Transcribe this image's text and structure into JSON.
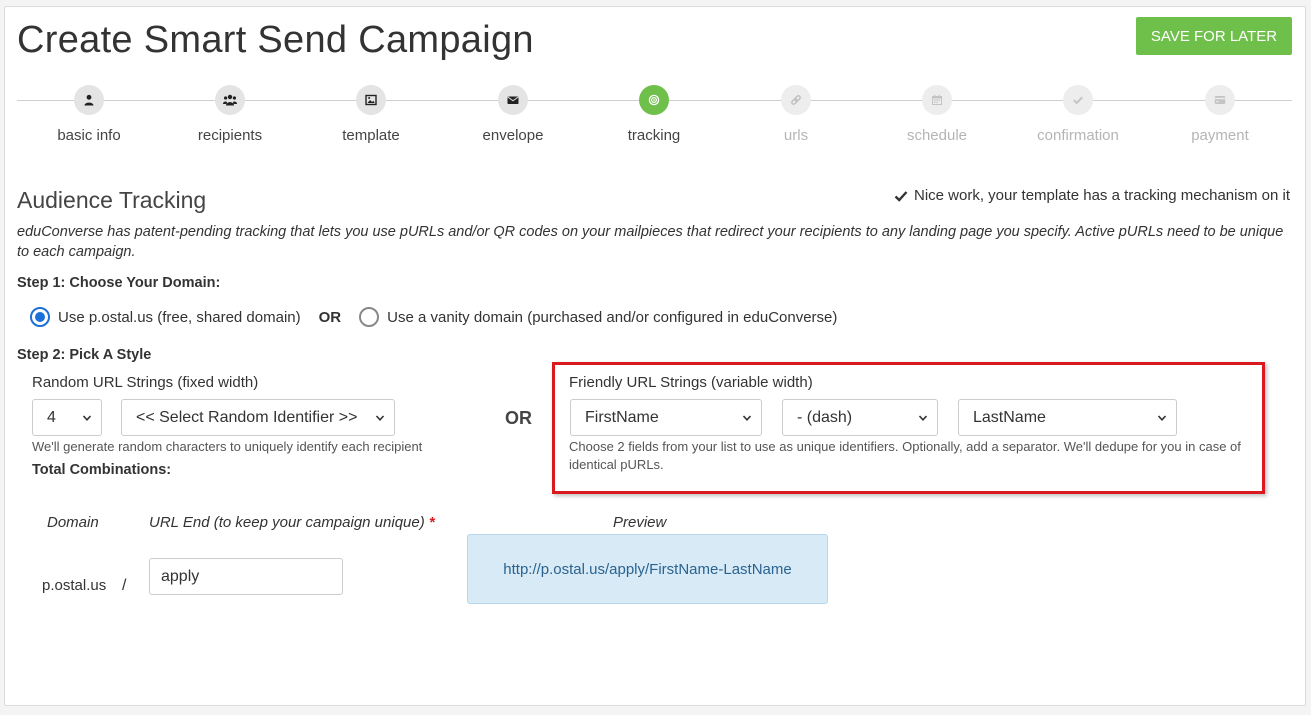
{
  "header": {
    "title": "Create Smart Send Campaign",
    "save_label": "SAVE FOR LATER"
  },
  "stepper": {
    "steps": [
      {
        "label": "basic info",
        "icon": "user-icon",
        "state": "complete"
      },
      {
        "label": "recipients",
        "icon": "users-icon",
        "state": "complete"
      },
      {
        "label": "template",
        "icon": "image-icon",
        "state": "complete"
      },
      {
        "label": "envelope",
        "icon": "envelope-icon",
        "state": "complete"
      },
      {
        "label": "tracking",
        "icon": "target-icon",
        "state": "active"
      },
      {
        "label": "urls",
        "icon": "link-icon",
        "state": "future"
      },
      {
        "label": "schedule",
        "icon": "calendar-icon",
        "state": "future"
      },
      {
        "label": "confirmation",
        "icon": "check-icon",
        "state": "future"
      },
      {
        "label": "payment",
        "icon": "credit-card-icon",
        "state": "future"
      }
    ]
  },
  "tracking": {
    "title": "Audience Tracking",
    "notice": "Nice work, your template has a tracking mechanism on it",
    "intro": "eduConverse has patent-pending tracking that lets you use pURLs and/or QR codes on your mailpieces that redirect your recipients to any landing page you specify. Active pURLs need to be unique to each campaign."
  },
  "step1": {
    "heading": "Step 1: Choose Your Domain:",
    "option_shared": "Use p.ostal.us (free, shared domain)",
    "or_label": "OR",
    "option_vanity": "Use a vanity domain (purchased and/or configured in eduConverse)",
    "selected": "shared"
  },
  "step2": {
    "heading": "Step 2: Pick A Style",
    "random": {
      "label": "Random URL Strings (fixed width)",
      "length_value": "4",
      "identifier_value": "<< Select Random Identifier >>",
      "help": "We'll generate random characters to uniquely identify each recipient",
      "total_label": "Total Combinations:"
    },
    "or_label": "OR",
    "friendly": {
      "label": "Friendly URL Strings (variable width)",
      "field1_value": "FirstName",
      "separator_value": "- (dash)",
      "field2_value": "LastName",
      "help": "Choose 2 fields from your list to use as unique identifiers. Optionally, add a separator. We'll dedupe for you in case of identical pURLs."
    }
  },
  "url_config": {
    "domain_header": "Domain",
    "url_end_header": "URL End (to keep your campaign unique)",
    "required_mark": "*",
    "preview_header": "Preview",
    "domain_value": "p.ostal.us",
    "slash": "/",
    "url_end_value": "apply",
    "preview_value": "http://p.ostal.us/apply/FirstName-LastName"
  },
  "colors": {
    "accent_green": "#6fbf4b",
    "radio_blue": "#1a6fd8",
    "highlight_red": "#d9191e",
    "preview_bg": "#d7eaf5"
  }
}
